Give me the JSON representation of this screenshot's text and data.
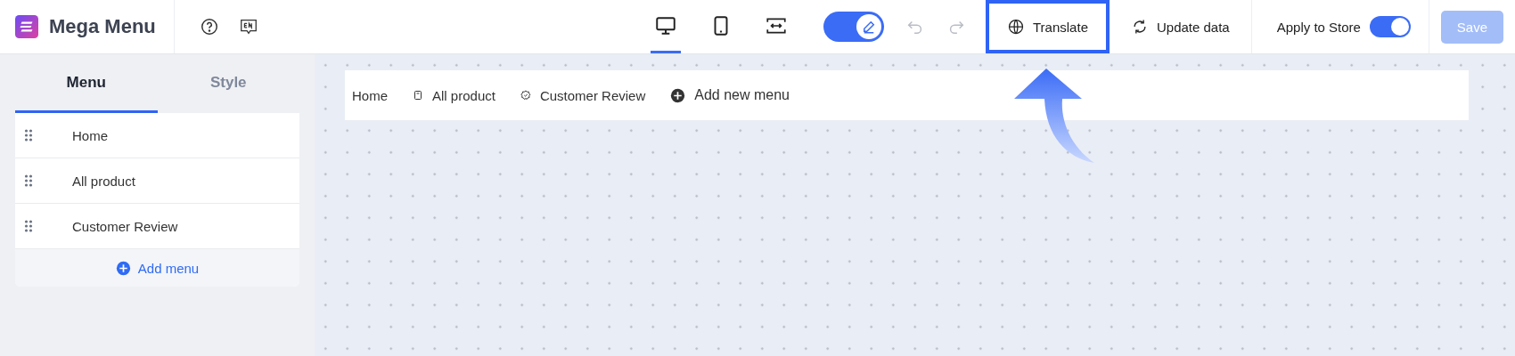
{
  "app": {
    "title": "Mega Menu"
  },
  "devices": [
    {
      "kind": "desktop",
      "selected": true
    },
    {
      "kind": "mobile",
      "selected": false
    },
    {
      "kind": "fit",
      "selected": false
    }
  ],
  "edit_toggle": {
    "on": true
  },
  "actions": [
    {
      "kind": "translate",
      "label": "Translate",
      "highlighted": true
    },
    {
      "kind": "update",
      "label": "Update data",
      "highlighted": false
    }
  ],
  "apply_to_store": {
    "label": "Apply to Store",
    "on": true
  },
  "save_button": {
    "label": "Save",
    "disabled": true
  },
  "tabs": [
    {
      "label": "Menu",
      "selected": true
    },
    {
      "label": "Style",
      "selected": false
    }
  ],
  "menu_items": [
    {
      "label": "Home"
    },
    {
      "label": "All product"
    },
    {
      "label": "Customer Review"
    }
  ],
  "add_menu": {
    "label": "Add menu"
  },
  "preview_menu": [
    {
      "label": "Home",
      "kind": "plain"
    },
    {
      "label": "All product",
      "kind": "page"
    },
    {
      "label": "Customer Review",
      "kind": "badge"
    }
  ],
  "add_new_menu": {
    "label": "Add new menu"
  }
}
